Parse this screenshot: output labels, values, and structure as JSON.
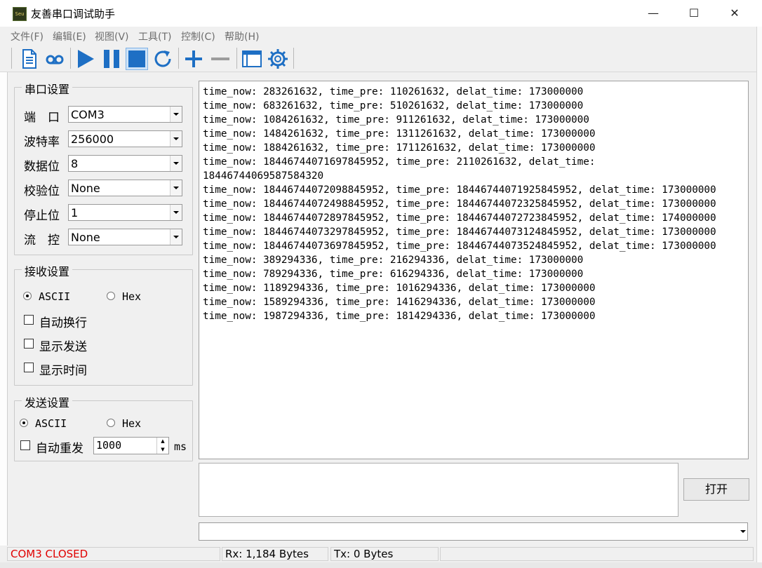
{
  "window": {
    "title": "友善串口调试助手",
    "icon_text": "Seu",
    "minimize": "—",
    "maximize": "☐",
    "close": "✕"
  },
  "menu": [
    "文件(F)",
    "编辑(E)",
    "视图(V)",
    "工具(T)",
    "控制(C)",
    "帮助(H)"
  ],
  "toolbar_icons": [
    "document-icon",
    "cassette-icon",
    "play-icon",
    "pause-icon",
    "stop-icon",
    "refresh-icon",
    "plus-icon",
    "minus-icon",
    "window-icon",
    "gear-icon"
  ],
  "serial_settings": {
    "title": "串口设置",
    "fields": [
      {
        "label": "端　口",
        "value": "COM3"
      },
      {
        "label": "波特率",
        "value": "256000"
      },
      {
        "label": "数据位",
        "value": "8"
      },
      {
        "label": "校验位",
        "value": "None"
      },
      {
        "label": "停止位",
        "value": "1"
      },
      {
        "label": "流　控",
        "value": "None"
      }
    ]
  },
  "receive_settings": {
    "title": "接收设置",
    "ascii": "ASCII",
    "hex": "Hex",
    "selected": "ASCII",
    "options": [
      "自动换行",
      "显示发送",
      "显示时间"
    ]
  },
  "send_settings": {
    "title": "发送设置",
    "ascii": "ASCII",
    "hex": "Hex",
    "selected": "ASCII",
    "auto_resend": "自动重发",
    "interval": "1000",
    "unit": "ms"
  },
  "receive_lines": [
    "time_now: 283261632, time_pre: 110261632, delat_time: 173000000",
    "time_now: 683261632, time_pre: 510261632, delat_time: 173000000",
    "time_now: 1084261632, time_pre: 911261632, delat_time: 173000000",
    "time_now: 1484261632, time_pre: 1311261632, delat_time: 173000000",
    "time_now: 1884261632, time_pre: 1711261632, delat_time: 173000000",
    "time_now: 18446744071697845952, time_pre: 2110261632, delat_time:",
    "18446744069587584320",
    "time_now: 18446744072098845952, time_pre: 18446744071925845952, delat_time: 173000000",
    "time_now: 18446744072498845952, time_pre: 18446744072325845952, delat_time: 173000000",
    "time_now: 18446744072897845952, time_pre: 18446744072723845952, delat_time: 174000000",
    "time_now: 18446744073297845952, time_pre: 18446744073124845952, delat_time: 173000000",
    "time_now: 18446744073697845952, time_pre: 18446744073524845952, delat_time: 173000000",
    "time_now: 389294336, time_pre: 216294336, delat_time: 173000000",
    "time_now: 789294336, time_pre: 616294336, delat_time: 173000000",
    "time_now: 1189294336, time_pre: 1016294336, delat_time: 173000000",
    "time_now: 1589294336, time_pre: 1416294336, delat_time: 173000000",
    "time_now: 1987294336, time_pre: 1814294336, delat_time: 173000000"
  ],
  "open_button": "打开",
  "status": {
    "port": "COM3 CLOSED",
    "port_color": "#e00000",
    "rx": "Rx: 1,184 Bytes",
    "tx": "Tx: 0 Bytes"
  },
  "colors": {
    "accent": "#1e6fc4"
  }
}
